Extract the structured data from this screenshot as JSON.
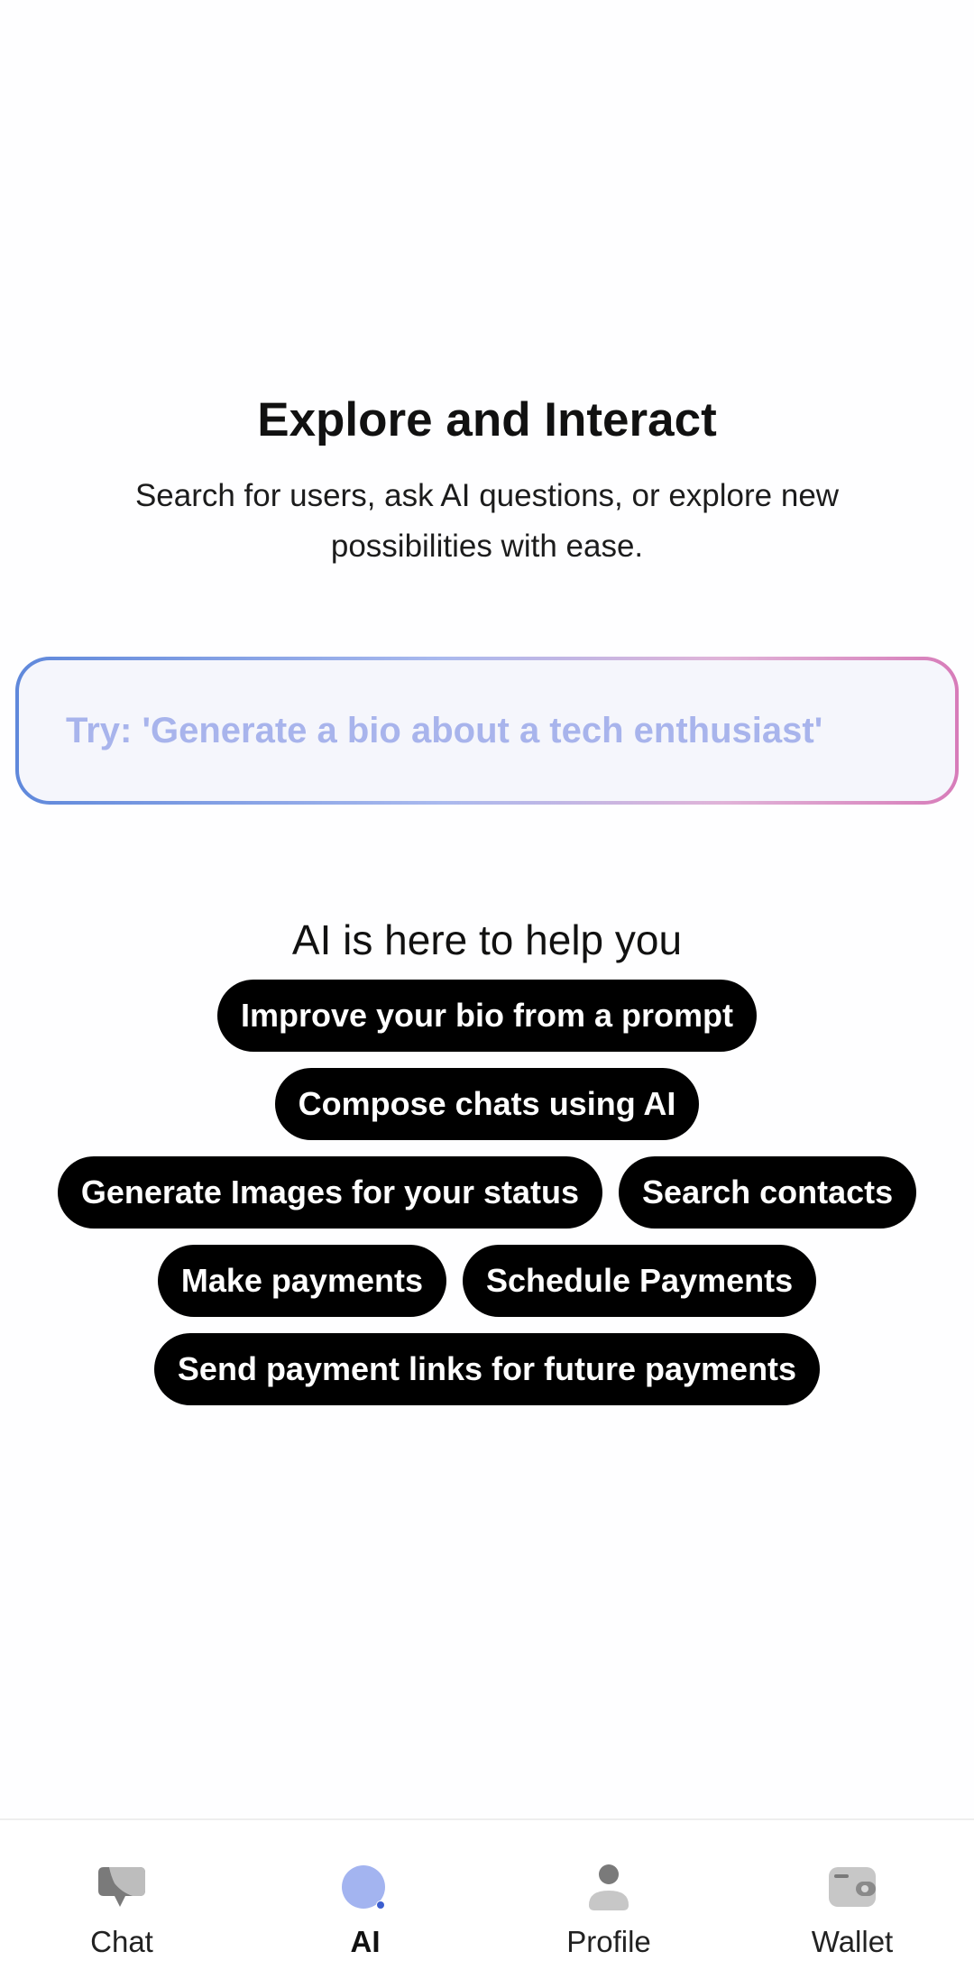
{
  "hero": {
    "title": "Explore and Interact",
    "subtitle": "Search for users, ask AI questions, or explore new possibilities with ease."
  },
  "prompt": {
    "placeholder": "Try: 'Generate a bio about a tech enthusiast'",
    "value": ""
  },
  "help": {
    "heading": "AI is here to help you",
    "chips": [
      "Improve your bio from a prompt",
      "Compose chats using AI",
      "Generate Images for your status",
      "Search contacts",
      "Make payments",
      "Schedule Payments",
      "Send payment links for future payments"
    ]
  },
  "nav": {
    "items": [
      {
        "label": "Chat",
        "icon": "chat-icon",
        "active": false
      },
      {
        "label": "AI",
        "icon": "ai-icon",
        "active": true
      },
      {
        "label": "Profile",
        "icon": "profile-icon",
        "active": false
      },
      {
        "label": "Wallet",
        "icon": "wallet-icon",
        "active": false
      }
    ]
  },
  "colors": {
    "accent": "#a3b4f0",
    "chip_bg": "#000000",
    "chip_text": "#ffffff",
    "gradient_start": "#5f88db",
    "gradient_end": "#d77cb9",
    "icon_gray": "#8a8a8a"
  }
}
